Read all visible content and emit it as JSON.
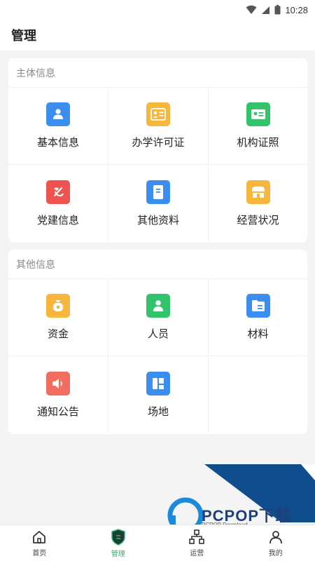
{
  "status_bar": {
    "time": "10:28"
  },
  "header": {
    "title": "管理"
  },
  "sections": [
    {
      "title": "主体信息",
      "items": [
        {
          "label": "基本信息",
          "icon": "person-card-icon",
          "color": "#3b8ef0"
        },
        {
          "label": "办学许可证",
          "icon": "license-icon",
          "color": "#f7b73c"
        },
        {
          "label": "机构证照",
          "icon": "id-card-icon",
          "color": "#33c46b"
        },
        {
          "label": "党建信息",
          "icon": "party-emblem-icon",
          "color": "#ef5350"
        },
        {
          "label": "其他资料",
          "icon": "document-icon",
          "color": "#3b8ef0"
        },
        {
          "label": "经营状况",
          "icon": "store-icon",
          "color": "#f7b73c"
        }
      ]
    },
    {
      "title": "其他信息",
      "items": [
        {
          "label": "资金",
          "icon": "money-bag-icon",
          "color": "#f7b73c"
        },
        {
          "label": "人员",
          "icon": "user-icon",
          "color": "#33c46b"
        },
        {
          "label": "材料",
          "icon": "folder-icon",
          "color": "#3b8ef0"
        },
        {
          "label": "通知公告",
          "icon": "speaker-icon",
          "color": "#f36c60"
        },
        {
          "label": "场地",
          "icon": "layout-icon",
          "color": "#3b8ef0"
        }
      ]
    }
  ],
  "watermark": {
    "brand": "PCPOP下载",
    "sub": "PCPOP Download"
  },
  "tabs": [
    {
      "label": "首页",
      "icon": "home-icon",
      "active": false
    },
    {
      "label": "管理",
      "icon": "shield-icon",
      "active": true
    },
    {
      "label": "运营",
      "icon": "org-chart-icon",
      "active": false
    },
    {
      "label": "我的",
      "icon": "user-icon",
      "active": false
    }
  ],
  "colors": {
    "accent": "#2db36f",
    "background": "#f4f4f4"
  }
}
